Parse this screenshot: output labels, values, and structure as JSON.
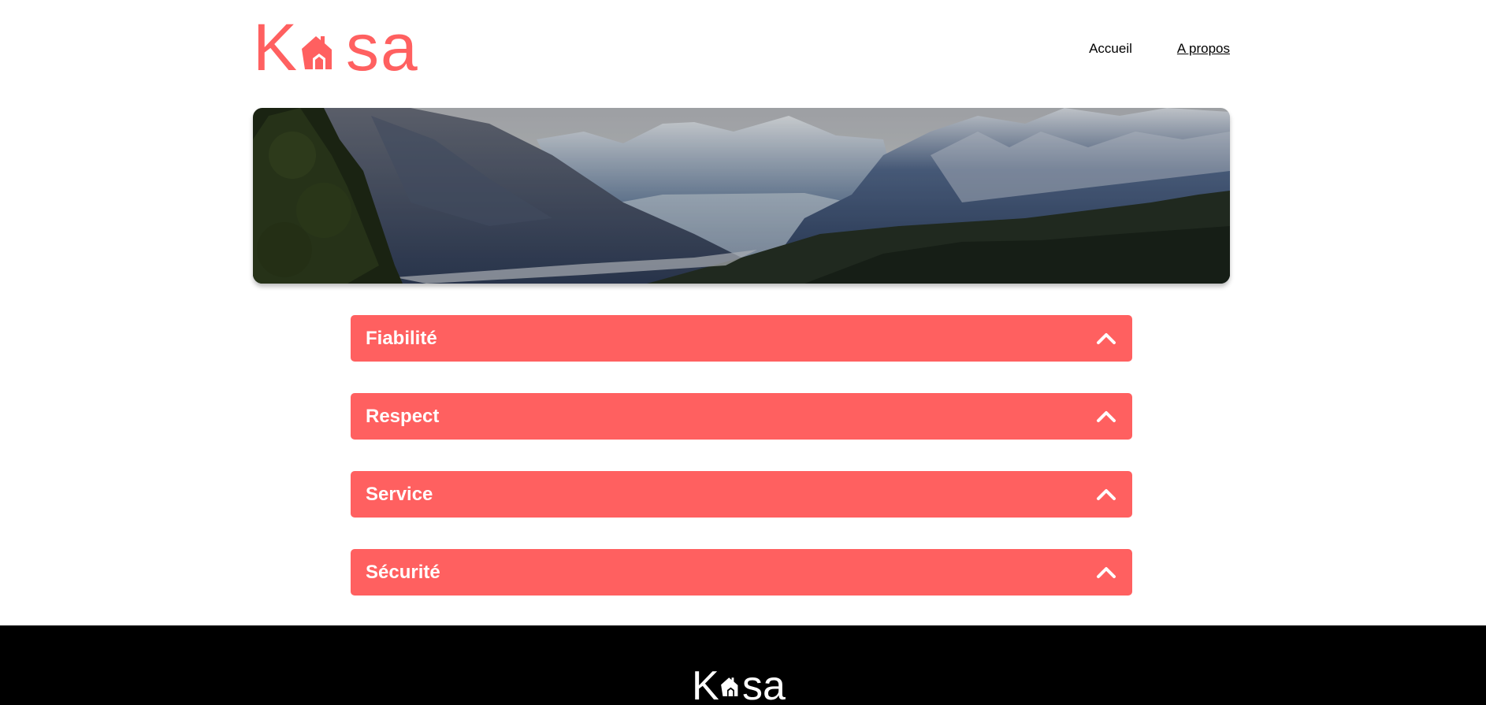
{
  "header": {
    "logo": {
      "part1": "K",
      "part2": "sa",
      "brand_color": "#FF6060",
      "icon": "house-icon"
    },
    "nav": [
      {
        "label": "Accueil",
        "active": false
      },
      {
        "label": "A propos",
        "active": true
      }
    ]
  },
  "banner": {
    "image": "mountain-valley-landscape"
  },
  "accordion": {
    "items": [
      {
        "title": "Fiabilité",
        "icon": "chevron-up-icon"
      },
      {
        "title": "Respect",
        "icon": "chevron-up-icon"
      },
      {
        "title": "Service",
        "icon": "chevron-up-icon"
      },
      {
        "title": "Sécurité",
        "icon": "chevron-up-icon"
      }
    ],
    "color": "#FF6060"
  },
  "footer": {
    "logo": {
      "part1": "K",
      "part2": "sa"
    }
  }
}
